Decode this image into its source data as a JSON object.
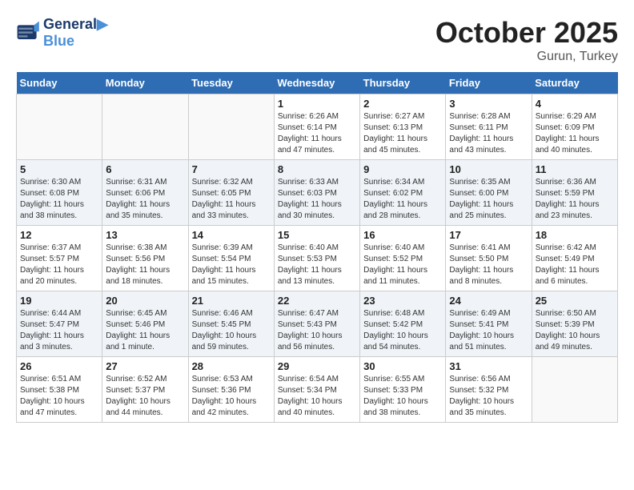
{
  "header": {
    "logo_line1": "General",
    "logo_line2": "Blue",
    "month": "October 2025",
    "location": "Gurun, Turkey"
  },
  "weekdays": [
    "Sunday",
    "Monday",
    "Tuesday",
    "Wednesday",
    "Thursday",
    "Friday",
    "Saturday"
  ],
  "weeks": [
    [
      {
        "day": "",
        "info": ""
      },
      {
        "day": "",
        "info": ""
      },
      {
        "day": "",
        "info": ""
      },
      {
        "day": "1",
        "info": "Sunrise: 6:26 AM\nSunset: 6:14 PM\nDaylight: 11 hours\nand 47 minutes."
      },
      {
        "day": "2",
        "info": "Sunrise: 6:27 AM\nSunset: 6:13 PM\nDaylight: 11 hours\nand 45 minutes."
      },
      {
        "day": "3",
        "info": "Sunrise: 6:28 AM\nSunset: 6:11 PM\nDaylight: 11 hours\nand 43 minutes."
      },
      {
        "day": "4",
        "info": "Sunrise: 6:29 AM\nSunset: 6:09 PM\nDaylight: 11 hours\nand 40 minutes."
      }
    ],
    [
      {
        "day": "5",
        "info": "Sunrise: 6:30 AM\nSunset: 6:08 PM\nDaylight: 11 hours\nand 38 minutes."
      },
      {
        "day": "6",
        "info": "Sunrise: 6:31 AM\nSunset: 6:06 PM\nDaylight: 11 hours\nand 35 minutes."
      },
      {
        "day": "7",
        "info": "Sunrise: 6:32 AM\nSunset: 6:05 PM\nDaylight: 11 hours\nand 33 minutes."
      },
      {
        "day": "8",
        "info": "Sunrise: 6:33 AM\nSunset: 6:03 PM\nDaylight: 11 hours\nand 30 minutes."
      },
      {
        "day": "9",
        "info": "Sunrise: 6:34 AM\nSunset: 6:02 PM\nDaylight: 11 hours\nand 28 minutes."
      },
      {
        "day": "10",
        "info": "Sunrise: 6:35 AM\nSunset: 6:00 PM\nDaylight: 11 hours\nand 25 minutes."
      },
      {
        "day": "11",
        "info": "Sunrise: 6:36 AM\nSunset: 5:59 PM\nDaylight: 11 hours\nand 23 minutes."
      }
    ],
    [
      {
        "day": "12",
        "info": "Sunrise: 6:37 AM\nSunset: 5:57 PM\nDaylight: 11 hours\nand 20 minutes."
      },
      {
        "day": "13",
        "info": "Sunrise: 6:38 AM\nSunset: 5:56 PM\nDaylight: 11 hours\nand 18 minutes."
      },
      {
        "day": "14",
        "info": "Sunrise: 6:39 AM\nSunset: 5:54 PM\nDaylight: 11 hours\nand 15 minutes."
      },
      {
        "day": "15",
        "info": "Sunrise: 6:40 AM\nSunset: 5:53 PM\nDaylight: 11 hours\nand 13 minutes."
      },
      {
        "day": "16",
        "info": "Sunrise: 6:40 AM\nSunset: 5:52 PM\nDaylight: 11 hours\nand 11 minutes."
      },
      {
        "day": "17",
        "info": "Sunrise: 6:41 AM\nSunset: 5:50 PM\nDaylight: 11 hours\nand 8 minutes."
      },
      {
        "day": "18",
        "info": "Sunrise: 6:42 AM\nSunset: 5:49 PM\nDaylight: 11 hours\nand 6 minutes."
      }
    ],
    [
      {
        "day": "19",
        "info": "Sunrise: 6:44 AM\nSunset: 5:47 PM\nDaylight: 11 hours\nand 3 minutes."
      },
      {
        "day": "20",
        "info": "Sunrise: 6:45 AM\nSunset: 5:46 PM\nDaylight: 11 hours\nand 1 minute."
      },
      {
        "day": "21",
        "info": "Sunrise: 6:46 AM\nSunset: 5:45 PM\nDaylight: 10 hours\nand 59 minutes."
      },
      {
        "day": "22",
        "info": "Sunrise: 6:47 AM\nSunset: 5:43 PM\nDaylight: 10 hours\nand 56 minutes."
      },
      {
        "day": "23",
        "info": "Sunrise: 6:48 AM\nSunset: 5:42 PM\nDaylight: 10 hours\nand 54 minutes."
      },
      {
        "day": "24",
        "info": "Sunrise: 6:49 AM\nSunset: 5:41 PM\nDaylight: 10 hours\nand 51 minutes."
      },
      {
        "day": "25",
        "info": "Sunrise: 6:50 AM\nSunset: 5:39 PM\nDaylight: 10 hours\nand 49 minutes."
      }
    ],
    [
      {
        "day": "26",
        "info": "Sunrise: 6:51 AM\nSunset: 5:38 PM\nDaylight: 10 hours\nand 47 minutes."
      },
      {
        "day": "27",
        "info": "Sunrise: 6:52 AM\nSunset: 5:37 PM\nDaylight: 10 hours\nand 44 minutes."
      },
      {
        "day": "28",
        "info": "Sunrise: 6:53 AM\nSunset: 5:36 PM\nDaylight: 10 hours\nand 42 minutes."
      },
      {
        "day": "29",
        "info": "Sunrise: 6:54 AM\nSunset: 5:34 PM\nDaylight: 10 hours\nand 40 minutes."
      },
      {
        "day": "30",
        "info": "Sunrise: 6:55 AM\nSunset: 5:33 PM\nDaylight: 10 hours\nand 38 minutes."
      },
      {
        "day": "31",
        "info": "Sunrise: 6:56 AM\nSunset: 5:32 PM\nDaylight: 10 hours\nand 35 minutes."
      },
      {
        "day": "",
        "info": ""
      }
    ]
  ]
}
